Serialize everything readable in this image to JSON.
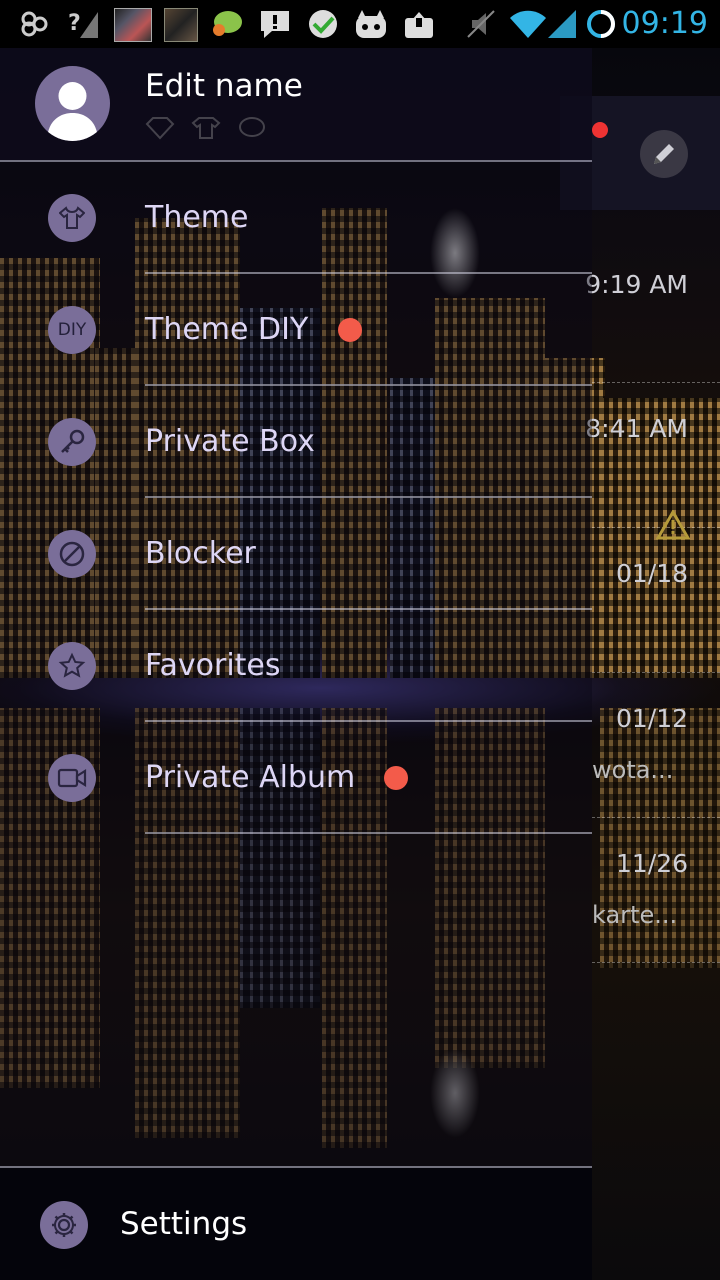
{
  "status_bar": {
    "time": "09:19",
    "icons": [
      "infinity-icon",
      "no-signal-icon",
      "app-thumbnail-icon",
      "app-thumbnail-icon",
      "chat-bubble-icon",
      "alert-icon",
      "app-check-icon",
      "cyanogen-icon",
      "upload-icon",
      "mute-icon",
      "wifi-icon",
      "signal-icon",
      "battery-circle-icon"
    ],
    "time_color": "#33b5e5"
  },
  "drawer": {
    "profile": {
      "name": "Edit name",
      "avatar_icon": "person-icon"
    },
    "items": [
      {
        "label": "Theme",
        "icon": "shirt-icon",
        "has_dot": false
      },
      {
        "label": "Theme DIY",
        "icon": "diy-icon",
        "icon_text": "DIY",
        "has_dot": true
      },
      {
        "label": "Private Box",
        "icon": "key-icon",
        "has_dot": false
      },
      {
        "label": "Blocker",
        "icon": "block-icon",
        "has_dot": false
      },
      {
        "label": "Favorites",
        "icon": "star-icon",
        "has_dot": false
      },
      {
        "label": "Private Album",
        "icon": "video-icon",
        "has_dot": true
      }
    ],
    "settings": {
      "label": "Settings",
      "icon": "gear-icon"
    },
    "accent_color": "#7a6e99",
    "dot_color": "#f35b4a"
  },
  "conversations": [
    {
      "time": "9:19 AM",
      "snippet": ""
    },
    {
      "time": "8:41 AM",
      "snippet": "",
      "warning": true
    },
    {
      "time": "01/18",
      "snippet": ""
    },
    {
      "time": "01/12",
      "snippet": "wota..."
    },
    {
      "time": "11/26",
      "snippet": "karte..."
    }
  ]
}
